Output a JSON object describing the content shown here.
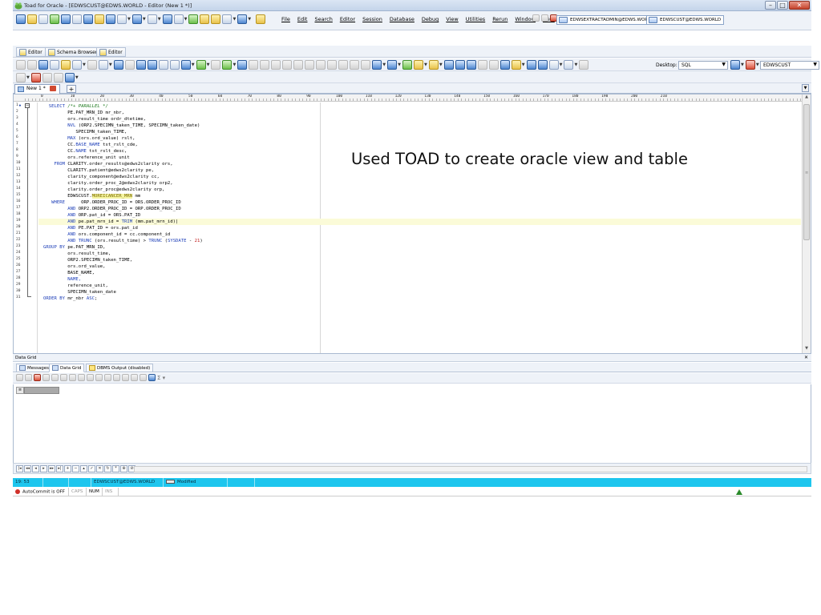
{
  "window": {
    "title": "Toad for Oracle - [EDWSCUST@EDWS.WORLD - Editor (New 1 *)]",
    "controls": [
      "–",
      "□",
      "✕"
    ]
  },
  "menubar": {
    "menus": [
      "File",
      "Edit",
      "Search",
      "Editor",
      "Session",
      "Database",
      "Debug",
      "View",
      "Utilities",
      "Rerun",
      "Window",
      "Help"
    ],
    "connections": [
      "EDWSEXTRACTADMIN@EDWS.WORLD",
      "EDWSCUST@EDWS.WORLD"
    ]
  },
  "window_tabs": [
    "Editor",
    "Schema Browser",
    "Editor"
  ],
  "toolbar": {
    "desktop_label": "Desktop:",
    "desktop_value": "SQL",
    "schema_value": "EDWSCUST"
  },
  "doc_tab": {
    "label": "New 1 *",
    "add": "+"
  },
  "ruler": [
    "0",
    "10",
    "20",
    "30",
    "40",
    "50",
    "60",
    "70",
    "80",
    "90",
    "100",
    "110",
    "120",
    "130",
    "140",
    "150",
    "160",
    "170",
    "180",
    "190",
    "200",
    "210"
  ],
  "editor": {
    "line_numbers": [
      "1",
      "2",
      "3",
      "4",
      "5",
      "6",
      "7",
      "8",
      "9",
      "10",
      "11",
      "12",
      "13",
      "14",
      "15",
      "16",
      "17",
      "18",
      "19",
      "20",
      "21",
      "22",
      "23",
      "24",
      "25",
      "26",
      "27",
      "28",
      "29",
      "30",
      "31"
    ],
    "lines": [
      [
        {
          "t": "  SELECT ",
          "c": "kw"
        },
        {
          "t": "/*+ PARALLEL */",
          "c": "cm"
        }
      ],
      [
        {
          "t": "         PE.PAT_MRN_ID mr_nbr,",
          "c": ""
        }
      ],
      [
        {
          "t": "         ors.result_time ordr_dtetime,",
          "c": ""
        }
      ],
      [
        {
          "t": "         NVL ",
          "c": "kw"
        },
        {
          "t": "(ORP2.SPECIMN_taken_TIME, SPECIMN_taken_date)",
          "c": ""
        }
      ],
      [
        {
          "t": "            SPECIMN_taken_TIME,",
          "c": ""
        }
      ],
      [
        {
          "t": "         MAX ",
          "c": "kw"
        },
        {
          "t": "(ors.ord_value) rslt,",
          "c": ""
        }
      ],
      [
        {
          "t": "         CC.",
          "c": ""
        },
        {
          "t": "BASE_NAME",
          "c": "kw"
        },
        {
          "t": " tst_rslt_cde,",
          "c": ""
        }
      ],
      [
        {
          "t": "         CC.",
          "c": ""
        },
        {
          "t": "NAME",
          "c": "kw"
        },
        {
          "t": " tst_rslt_desc,",
          "c": ""
        }
      ],
      [
        {
          "t": "         ors.reference_unit unit",
          "c": ""
        }
      ],
      [
        {
          "t": "    FROM ",
          "c": "kw"
        },
        {
          "t": "CLARITY.order_results@edws2clarity ors,",
          "c": ""
        }
      ],
      [
        {
          "t": "         CLARITY.patient@edws2clarity pe,",
          "c": ""
        }
      ],
      [
        {
          "t": "         clarity_component@edws2clarity cc,",
          "c": ""
        }
      ],
      [
        {
          "t": "         clarity.order_proc_2@edws2clarity orp2,",
          "c": ""
        }
      ],
      [
        {
          "t": "         clarity.order_proc@edws2clarity orp,",
          "c": ""
        }
      ],
      [
        {
          "t": "         EDWSCUST.",
          "c": ""
        },
        {
          "t": "MOREICANCER_MRN",
          "c": "hl"
        },
        {
          "t": " mm",
          "c": ""
        }
      ],
      [
        {
          "t": "   WHERE ",
          "c": "kw"
        },
        {
          "t": "     ORP.ORDER_PROC_ID = ORS.ORDER_PROC_ID",
          "c": ""
        }
      ],
      [
        {
          "t": "         AND ",
          "c": "kw"
        },
        {
          "t": "ORP2.ORDER_PROC_ID = ORP.ORDER_PROC_ID",
          "c": ""
        }
      ],
      [
        {
          "t": "         AND ",
          "c": "kw"
        },
        {
          "t": "ORP.pat_id = ORS.PAT_ID",
          "c": ""
        }
      ],
      [
        {
          "t": "         AND ",
          "c": "kw"
        },
        {
          "t": "pe.pat_mrn_id = ",
          "c": ""
        },
        {
          "t": "TRIM",
          "c": "kw"
        },
        {
          "t": " (mm.pat_mrn_id)|",
          "c": ""
        }
      ],
      [
        {
          "t": "         AND ",
          "c": "kw"
        },
        {
          "t": "PE.PAT_ID = ors.pat_id",
          "c": ""
        }
      ],
      [
        {
          "t": "         AND ",
          "c": "kw"
        },
        {
          "t": "ors.component_id = cc.component_id",
          "c": ""
        }
      ],
      [
        {
          "t": "         AND ",
          "c": "kw"
        },
        {
          "t": "TRUNC",
          "c": "kw"
        },
        {
          "t": " (ors.result_time) > ",
          "c": ""
        },
        {
          "t": "TRUNC",
          "c": "kw"
        },
        {
          "t": " (",
          "c": ""
        },
        {
          "t": "SYSDATE",
          "c": "kw"
        },
        {
          "t": " - ",
          "c": ""
        },
        {
          "t": "21",
          "c": "num"
        },
        {
          "t": ")",
          "c": ""
        }
      ],
      [
        {
          "t": "GROUP BY ",
          "c": "kw"
        },
        {
          "t": "pe.PAT_MRN_ID,",
          "c": ""
        }
      ],
      [
        {
          "t": "         ors.result_time,",
          "c": ""
        }
      ],
      [
        {
          "t": "         ORP2.SPECIMN_taken_TIME,",
          "c": ""
        }
      ],
      [
        {
          "t": "         ors.ord_value,",
          "c": ""
        }
      ],
      [
        {
          "t": "         BASE_NAME,",
          "c": ""
        }
      ],
      [
        {
          "t": "         NAME,",
          "c": "kw"
        }
      ],
      [
        {
          "t": "         reference_unit,",
          "c": ""
        }
      ],
      [
        {
          "t": "         SPECIMN_taken_date",
          "c": ""
        }
      ],
      [
        {
          "t": "ORDER BY ",
          "c": "kw"
        },
        {
          "t": "mr_nbr ",
          "c": ""
        },
        {
          "t": "ASC",
          "c": "kw"
        },
        {
          "t": ";",
          "c": ""
        }
      ]
    ]
  },
  "annotation": "Used TOAD to create oracle view and table",
  "data_grid": {
    "header": "Data Grid",
    "close": "✕",
    "tabs": [
      "Messages",
      "Data Grid",
      "DBMS Output (disabled)"
    ]
  },
  "status": {
    "position": "19: 53",
    "connection": "EDWSCUST@EDWS.WORLD",
    "state": "Modified",
    "autocommit": "AutoCommit is OFF",
    "caps": "CAPS",
    "num": "NUM",
    "ins": "INS"
  }
}
